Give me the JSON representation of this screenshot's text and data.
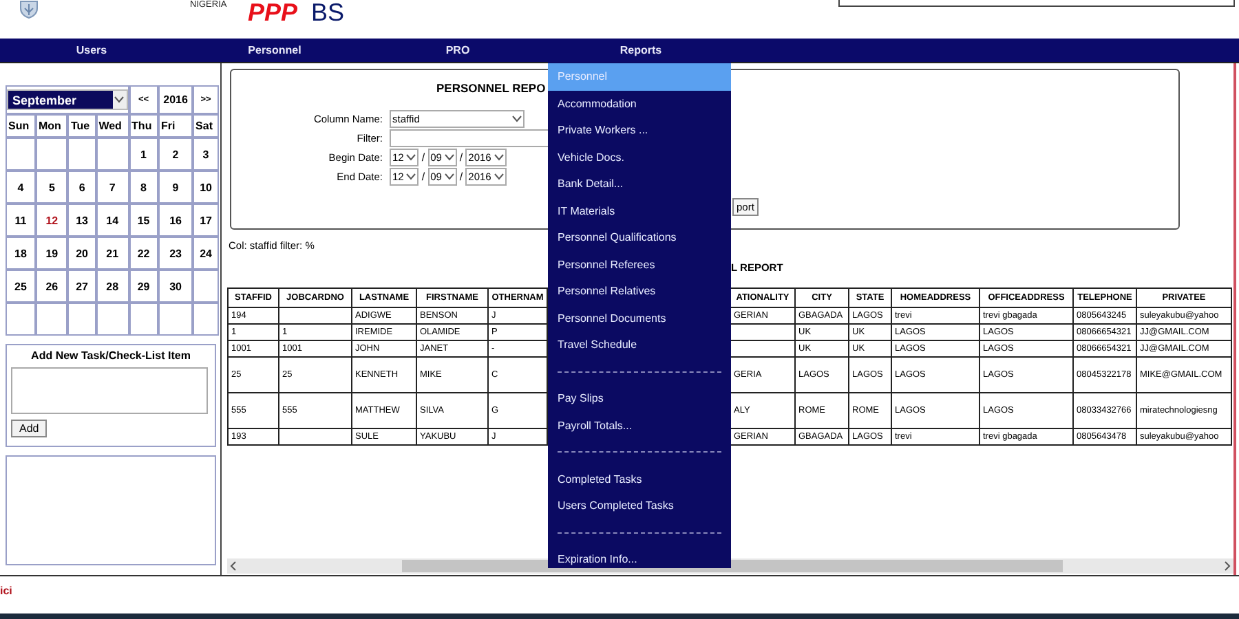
{
  "header": {
    "country": "NIGERIA",
    "brand_red": "PPP",
    "brand_blue": "BS"
  },
  "nav": [
    "Users",
    "Personnel",
    "PRO",
    "Reports"
  ],
  "calendar": {
    "month": "September",
    "prev": "<<",
    "year": "2016",
    "next": ">>",
    "weekdays": [
      "Sun",
      "Mon",
      "Tue",
      "Wed",
      "Thu",
      "Fri",
      "Sat"
    ],
    "weeks": [
      [
        {
          "kind": "blank"
        },
        {
          "kind": "blank"
        },
        {
          "kind": "blank"
        },
        {
          "kind": "blank"
        },
        {
          "kind": "day",
          "d": "1",
          "today": false
        },
        {
          "kind": "day",
          "d": "2",
          "today": false
        },
        {
          "kind": "day",
          "d": "3",
          "today": false
        }
      ],
      [
        {
          "kind": "day",
          "d": "4",
          "today": false
        },
        {
          "kind": "day",
          "d": "5",
          "today": false
        },
        {
          "kind": "day",
          "d": "6",
          "today": false
        },
        {
          "kind": "day",
          "d": "7",
          "today": false
        },
        {
          "kind": "day",
          "d": "8",
          "today": false
        },
        {
          "kind": "day",
          "d": "9",
          "today": false
        },
        {
          "kind": "day",
          "d": "10",
          "today": false
        }
      ],
      [
        {
          "kind": "day",
          "d": "11",
          "today": false
        },
        {
          "kind": "day",
          "d": "12",
          "today": true
        },
        {
          "kind": "day",
          "d": "13",
          "today": false
        },
        {
          "kind": "day",
          "d": "14",
          "today": false
        },
        {
          "kind": "day",
          "d": "15",
          "today": false
        },
        {
          "kind": "day",
          "d": "16",
          "today": false
        },
        {
          "kind": "day",
          "d": "17",
          "today": false
        }
      ],
      [
        {
          "kind": "day",
          "d": "18",
          "today": false
        },
        {
          "kind": "day",
          "d": "19",
          "today": false
        },
        {
          "kind": "day",
          "d": "20",
          "today": false
        },
        {
          "kind": "day",
          "d": "21",
          "today": false
        },
        {
          "kind": "day",
          "d": "22",
          "today": false
        },
        {
          "kind": "day",
          "d": "23",
          "today": false
        },
        {
          "kind": "day",
          "d": "24",
          "today": false
        }
      ],
      [
        {
          "kind": "day",
          "d": "25",
          "today": false
        },
        {
          "kind": "day",
          "d": "26",
          "today": false
        },
        {
          "kind": "day",
          "d": "27",
          "today": false
        },
        {
          "kind": "day",
          "d": "28",
          "today": false
        },
        {
          "kind": "day",
          "d": "29",
          "today": false
        },
        {
          "kind": "day",
          "d": "30",
          "today": false
        },
        {
          "kind": "blank"
        }
      ],
      [
        {
          "kind": "blank"
        },
        {
          "kind": "blank"
        },
        {
          "kind": "blank"
        },
        {
          "kind": "blank"
        },
        {
          "kind": "blank"
        },
        {
          "kind": "blank"
        },
        {
          "kind": "blank"
        }
      ]
    ]
  },
  "task": {
    "title": "Add New Task/Check-List Item",
    "button": "Add"
  },
  "report": {
    "title": "PERSONNEL REPO",
    "fields": [
      {
        "label": "Column Name:",
        "kind": "select",
        "value": "staffid"
      },
      {
        "label": "Filter:",
        "kind": "text"
      },
      {
        "label": "Begin Date:",
        "kind": "date",
        "parts": [
          {
            "kind": "select",
            "value": "12"
          },
          {
            "kind": "sep",
            "text": "/"
          },
          {
            "kind": "select",
            "value": "09"
          },
          {
            "kind": "sep",
            "text": "/"
          },
          {
            "kind": "select",
            "value": "2016"
          }
        ]
      },
      {
        "label": "End Date:",
        "kind": "date",
        "parts": [
          {
            "kind": "select",
            "value": "12"
          },
          {
            "kind": "sep",
            "text": "/"
          },
          {
            "kind": "select",
            "value": "09"
          },
          {
            "kind": "sep",
            "text": "/"
          },
          {
            "kind": "select",
            "value": "2016"
          }
        ]
      }
    ],
    "button": "port"
  },
  "summary": "Col: staffid filter: %",
  "table_title": "L REPORT",
  "table": {
    "left_columns": [
      "STAFFID",
      "JOBCARDNO",
      "LASTNAME",
      "FIRSTNAME",
      "OTHERNAM"
    ],
    "right_columns": [
      "ATIONALITY",
      "CITY",
      "STATE",
      "HOMEADDRESS",
      "OFFICEADDRESS",
      "TELEPHONE",
      "PRIVATEE"
    ],
    "rows": [
      {
        "left": [
          {
            "kind": "text",
            "text": "194"
          },
          {
            "kind": "empty"
          },
          {
            "kind": "text",
            "text": "ADIGWE"
          },
          {
            "kind": "text",
            "text": "BENSON"
          },
          {
            "kind": "text",
            "text": "J"
          }
        ],
        "right": [
          {
            "kind": "text",
            "text": "GERIAN"
          },
          {
            "kind": "text",
            "text": "GBAGADA"
          },
          {
            "kind": "text",
            "text": "LAGOS"
          },
          {
            "kind": "text",
            "text": "trevi"
          },
          {
            "kind": "text",
            "text": "trevi gbagada"
          },
          {
            "kind": "text",
            "text": "0805643245"
          },
          {
            "kind": "text",
            "text": "suleyakubu@yahoo"
          }
        ]
      },
      {
        "left": [
          {
            "kind": "text",
            "text": "1"
          },
          {
            "kind": "text",
            "text": "1"
          },
          {
            "kind": "text",
            "text": "IREMIDE"
          },
          {
            "kind": "text",
            "text": "OLAMIDE"
          },
          {
            "kind": "text",
            "text": "P"
          }
        ],
        "right": [
          {
            "kind": "empty"
          },
          {
            "kind": "text",
            "text": "UK"
          },
          {
            "kind": "text",
            "text": "UK"
          },
          {
            "kind": "text",
            "text": "LAGOS"
          },
          {
            "kind": "text",
            "text": "LAGOS"
          },
          {
            "kind": "text",
            "text": "08066654321"
          },
          {
            "kind": "text",
            "text": "JJ@GMAIL.COM"
          }
        ]
      },
      {
        "left": [
          {
            "kind": "text",
            "text": "1001"
          },
          {
            "kind": "text",
            "text": "1001"
          },
          {
            "kind": "text",
            "text": "JOHN"
          },
          {
            "kind": "text",
            "text": "JANET"
          },
          {
            "kind": "text",
            "text": "-"
          }
        ],
        "right": [
          {
            "kind": "empty"
          },
          {
            "kind": "text",
            "text": "UK"
          },
          {
            "kind": "text",
            "text": "UK"
          },
          {
            "kind": "text",
            "text": "LAGOS"
          },
          {
            "kind": "text",
            "text": "LAGOS"
          },
          {
            "kind": "text",
            "text": "08066654321"
          },
          {
            "kind": "text",
            "text": "JJ@GMAIL.COM"
          }
        ]
      },
      {
        "left": [
          {
            "kind": "text",
            "text": "25"
          },
          {
            "kind": "text",
            "text": "25"
          },
          {
            "kind": "text",
            "text": "KENNETH"
          },
          {
            "kind": "text",
            "text": "MIKE"
          },
          {
            "kind": "text",
            "text": "C"
          }
        ],
        "right": [
          {
            "kind": "text",
            "text": "GERIA"
          },
          {
            "kind": "text",
            "text": "LAGOS"
          },
          {
            "kind": "text",
            "text": "LAGOS"
          },
          {
            "kind": "text",
            "text": "LAGOS"
          },
          {
            "kind": "text",
            "text": "LAGOS"
          },
          {
            "kind": "text",
            "text": "08045322178"
          },
          {
            "kind": "text",
            "text": "MIKE@GMAIL.COM"
          }
        ]
      },
      {
        "left": [
          {
            "kind": "text",
            "text": "555"
          },
          {
            "kind": "text",
            "text": "555"
          },
          {
            "kind": "text",
            "text": "MATTHEW"
          },
          {
            "kind": "text",
            "text": "SILVA"
          },
          {
            "kind": "text",
            "text": "G"
          }
        ],
        "right": [
          {
            "kind": "text",
            "text": "ALY"
          },
          {
            "kind": "text",
            "text": "ROME"
          },
          {
            "kind": "text",
            "text": "ROME"
          },
          {
            "kind": "text",
            "text": "LAGOS"
          },
          {
            "kind": "text",
            "text": "LAGOS"
          },
          {
            "kind": "text",
            "text": "08033432766"
          },
          {
            "kind": "text",
            "text": "miratechnologiesng"
          }
        ]
      },
      {
        "left": [
          {
            "kind": "text",
            "text": "193"
          },
          {
            "kind": "empty"
          },
          {
            "kind": "text",
            "text": "SULE"
          },
          {
            "kind": "text",
            "text": "YAKUBU"
          },
          {
            "kind": "text",
            "text": "J"
          }
        ],
        "right": [
          {
            "kind": "text",
            "text": "GERIAN"
          },
          {
            "kind": "text",
            "text": "GBAGADA"
          },
          {
            "kind": "text",
            "text": "LAGOS"
          },
          {
            "kind": "text",
            "text": "trevi"
          },
          {
            "kind": "text",
            "text": "trevi gbagada"
          },
          {
            "kind": "text",
            "text": "0805643478"
          },
          {
            "kind": "text",
            "text": "suleyakubu@yahoo"
          }
        ]
      }
    ]
  },
  "menu": [
    {
      "kind": "item",
      "label": "Personnel",
      "selected": true
    },
    {
      "kind": "item",
      "label": "Accommodation",
      "selected": false
    },
    {
      "kind": "item",
      "label": "Private Workers ...",
      "selected": false
    },
    {
      "kind": "item",
      "label": "Vehicle Docs.",
      "selected": false
    },
    {
      "kind": "item",
      "label": "Bank Detail...",
      "selected": false
    },
    {
      "kind": "item",
      "label": "IT Materials",
      "selected": false
    },
    {
      "kind": "item",
      "label": "Personnel Qualifications",
      "selected": false
    },
    {
      "kind": "item",
      "label": "Personnel Referees",
      "selected": false
    },
    {
      "kind": "item",
      "label": "Personnel Relatives",
      "selected": false
    },
    {
      "kind": "item",
      "label": "Personnel Documents",
      "selected": false
    },
    {
      "kind": "item",
      "label": "Travel Schedule",
      "selected": false
    },
    {
      "kind": "separator"
    },
    {
      "kind": "item",
      "label": "Pay Slips",
      "selected": false
    },
    {
      "kind": "item",
      "label": "Payroll Totals...",
      "selected": false
    },
    {
      "kind": "separator"
    },
    {
      "kind": "item",
      "label": "Completed Tasks",
      "selected": false
    },
    {
      "kind": "item",
      "label": "Users Completed Tasks",
      "selected": false
    },
    {
      "kind": "separator"
    },
    {
      "kind": "item",
      "label": "Expiration Info...",
      "selected": false
    }
  ],
  "footer": "ici"
}
